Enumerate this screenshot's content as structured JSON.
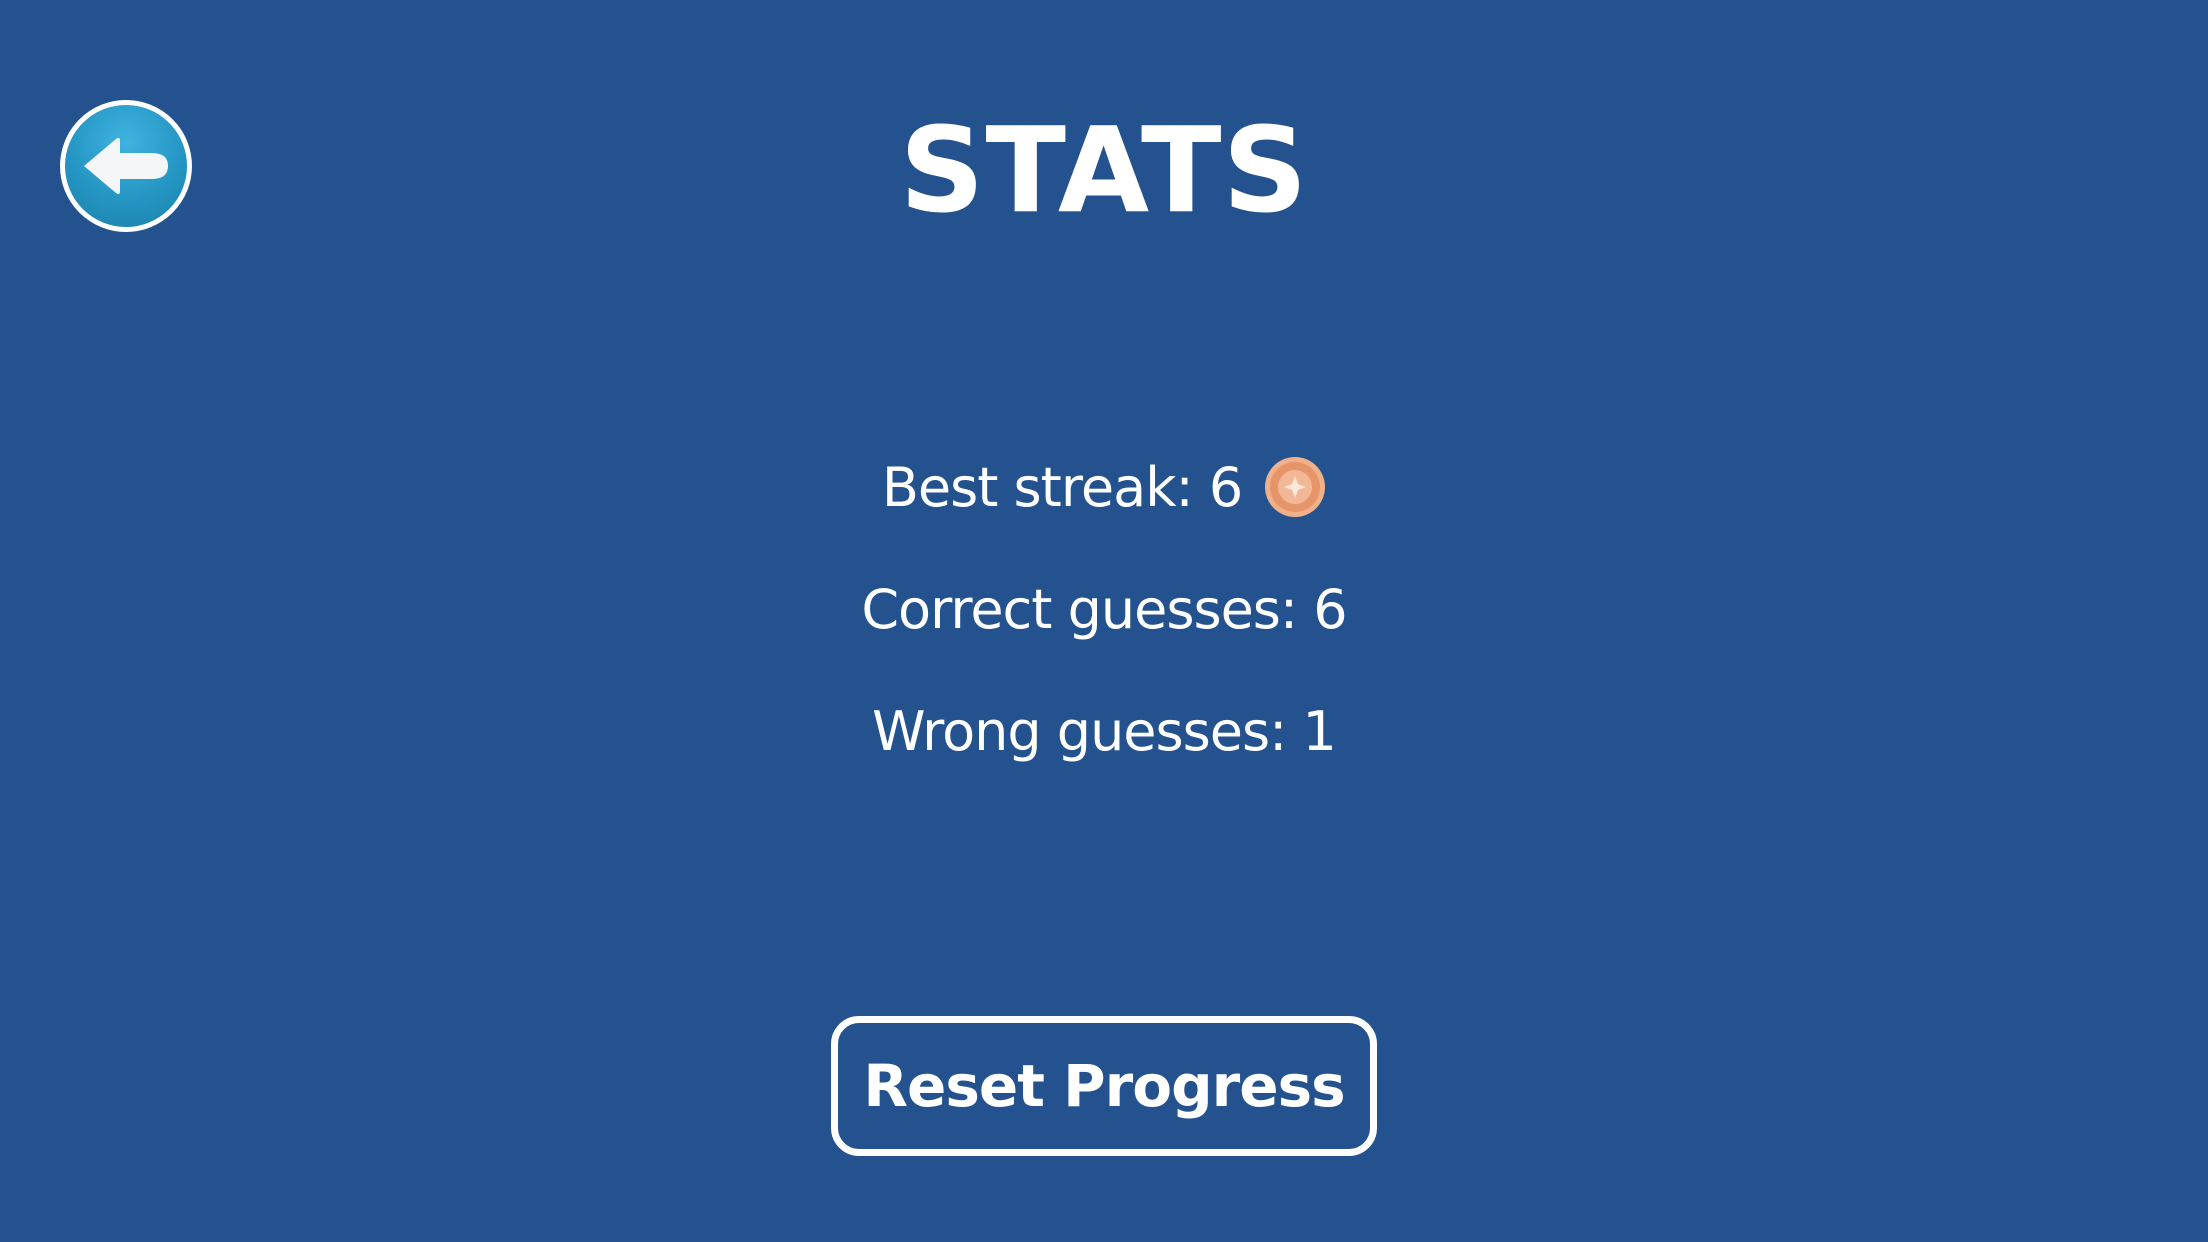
{
  "header": {
    "back_icon": "arrow-left-icon",
    "title": "STATS"
  },
  "stats": {
    "best_streak": {
      "text": "Best streak: 6",
      "medal_icon": "bronze-medal-icon"
    },
    "correct_guesses": {
      "text": "Correct guesses: 6"
    },
    "wrong_guesses": {
      "text": "Wrong guesses: 1"
    }
  },
  "actions": {
    "reset_label": "Reset Progress"
  },
  "colors": {
    "background": "#23528f",
    "text": "#ffffff",
    "back_button": "#2596c4",
    "medal": "#e89a6f"
  }
}
